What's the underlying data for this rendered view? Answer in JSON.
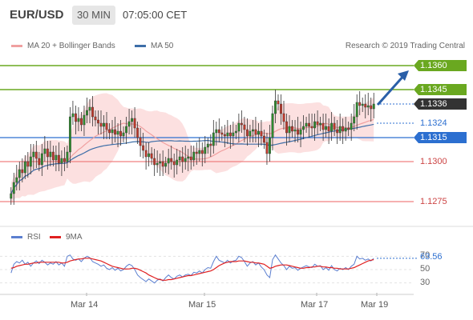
{
  "header": {
    "pair": "EUR/USD",
    "timeframe": "30 MIN",
    "time": "07:05:00 CET"
  },
  "legend": {
    "ma20_bb": "MA 20 + Bollinger Bands",
    "ma50": "MA 50",
    "credit": "Research © 2019 Trading Central",
    "rsi": "RSI",
    "ma9": "9MA"
  },
  "colors": {
    "bollinger_fill": "#fbd6d6",
    "ma20": "#f0a0a0",
    "ma50": "#3d6ea8",
    "resistance": "#6aa820",
    "support": "#f08080",
    "pivot": "#2c6fd0",
    "arrow": "#2a5fa8",
    "candle_up": "#2e8b2e",
    "candle_down": "#c0392b",
    "rsi_line": "#5b7fd0",
    "ma9_line": "#e02020",
    "current_box": "#333333"
  },
  "chart_data": [
    {
      "type": "candlestick",
      "title": "EUR/USD",
      "ylim": [
        1.1265,
        1.1365
      ],
      "x_ticks": [
        "Mar 14",
        "Mar 15",
        "Mar 17",
        "Mar 19"
      ],
      "levels": [
        {
          "label": "1.1360",
          "value": 1.136,
          "kind": "resistance"
        },
        {
          "label": "1.1345",
          "value": 1.1345,
          "kind": "resistance"
        },
        {
          "label": "1.1336",
          "value": 1.1336,
          "kind": "current"
        },
        {
          "label": "1.1324",
          "value": 1.1324,
          "kind": "last"
        },
        {
          "label": "1.1315",
          "value": 1.1315,
          "kind": "pivot"
        },
        {
          "label": "1.1300",
          "value": 1.13,
          "kind": "support"
        },
        {
          "label": "1.1275",
          "value": 1.1275,
          "kind": "support"
        }
      ],
      "arrow_target": 1.136,
      "close": [
        1.128,
        1.1287,
        1.129,
        1.1295,
        1.1293,
        1.13,
        1.1297,
        1.1303,
        1.1306,
        1.1302,
        1.1298,
        1.1305,
        1.1308,
        1.1303,
        1.1306,
        1.1301,
        1.1304,
        1.1299,
        1.1302,
        1.13,
        1.1306,
        1.1328,
        1.133,
        1.1325,
        1.1327,
        1.1323,
        1.1329,
        1.1332,
        1.1334,
        1.1328,
        1.1326,
        1.1324,
        1.1322,
        1.1324,
        1.132,
        1.1318,
        1.132,
        1.1317,
        1.1319,
        1.1316,
        1.1318,
        1.1322,
        1.1325,
        1.1327,
        1.1321,
        1.1315,
        1.131,
        1.1307,
        1.1303,
        1.1305,
        1.1302,
        1.1298,
        1.1299,
        1.13,
        1.1297,
        1.1299,
        1.1302,
        1.13,
        1.1298,
        1.1301,
        1.1303,
        1.13,
        1.1302,
        1.1303,
        1.1301,
        1.1306,
        1.1305,
        1.1307,
        1.1305,
        1.1309,
        1.1311,
        1.131,
        1.1318,
        1.132,
        1.1318,
        1.1317,
        1.1316,
        1.1318,
        1.1316,
        1.1318,
        1.1319,
        1.1324,
        1.1323,
        1.132,
        1.1316,
        1.1319,
        1.132,
        1.1317,
        1.1319,
        1.1316,
        1.1312,
        1.1305,
        1.1315,
        1.133,
        1.1338,
        1.1336,
        1.133,
        1.1325,
        1.1318,
        1.1322,
        1.1319,
        1.132,
        1.1317,
        1.132,
        1.1322,
        1.1324,
        1.1322,
        1.1321,
        1.1325,
        1.1323,
        1.1324,
        1.132,
        1.1322,
        1.1319,
        1.1324,
        1.132,
        1.1318,
        1.1322,
        1.1319,
        1.1321,
        1.132,
        1.1324,
        1.1328,
        1.1337,
        1.1335,
        1.1336,
        1.1334,
        1.1335,
        1.1333,
        1.1336
      ]
    },
    {
      "type": "line",
      "title": "RSI",
      "ylim": [
        20,
        80
      ],
      "y_ticks": [
        30,
        50,
        70
      ],
      "series": [
        {
          "name": "RSI",
          "values": [
            45,
            58,
            62,
            60,
            64,
            58,
            61,
            55,
            60,
            63,
            59,
            64,
            61,
            57,
            60,
            58,
            62,
            57,
            60,
            55,
            70,
            72,
            66,
            64,
            66,
            62,
            67,
            70,
            68,
            62,
            60,
            58,
            55,
            57,
            52,
            50,
            53,
            49,
            52,
            48,
            50,
            55,
            58,
            56,
            50,
            42,
            38,
            35,
            32,
            36,
            33,
            30,
            34,
            36,
            33,
            38,
            42,
            38,
            36,
            40,
            42,
            39,
            42,
            43,
            41,
            46,
            45,
            48,
            45,
            50,
            53,
            52,
            62,
            70,
            64,
            62,
            60,
            64,
            60,
            63,
            64,
            70,
            68,
            62,
            55,
            60,
            62,
            57,
            60,
            54,
            50,
            42,
            38,
            65,
            72,
            66,
            60,
            56,
            50,
            55,
            52,
            53,
            49,
            52,
            54,
            56,
            54,
            53,
            58,
            55,
            56,
            50,
            53,
            49,
            56,
            50,
            48,
            52,
            50,
            53,
            50,
            55,
            58,
            70,
            66,
            67,
            64,
            66,
            63,
            67
          ]
        },
        {
          "name": "9MA",
          "values": [
            52,
            53,
            55,
            56,
            57,
            58,
            58,
            59,
            60,
            60,
            61,
            61,
            61,
            61,
            61,
            61,
            61,
            61,
            60,
            60,
            61,
            63,
            64,
            65,
            66,
            66,
            67,
            67,
            67,
            66,
            65,
            64,
            63,
            61,
            59,
            57,
            55,
            54,
            53,
            52,
            51,
            51,
            51,
            52,
            52,
            51,
            49,
            47,
            45,
            42,
            40,
            38,
            36,
            35,
            34,
            34,
            35,
            35,
            36,
            37,
            38,
            39,
            40,
            41,
            41,
            42,
            43,
            44,
            45,
            46,
            47,
            48,
            50,
            53,
            56,
            58,
            60,
            61,
            62,
            62,
            62,
            63,
            63,
            63,
            62,
            61,
            61,
            60,
            60,
            59,
            58,
            55,
            52,
            53,
            55,
            56,
            57,
            57,
            57,
            56,
            55,
            54,
            53,
            52,
            52,
            53,
            53,
            54,
            54,
            55,
            55,
            54,
            54,
            53,
            53,
            52,
            52,
            51,
            51,
            51,
            51,
            52,
            53,
            55,
            57,
            59,
            61,
            63,
            64,
            65
          ]
        }
      ],
      "current_label": "63.56"
    }
  ]
}
